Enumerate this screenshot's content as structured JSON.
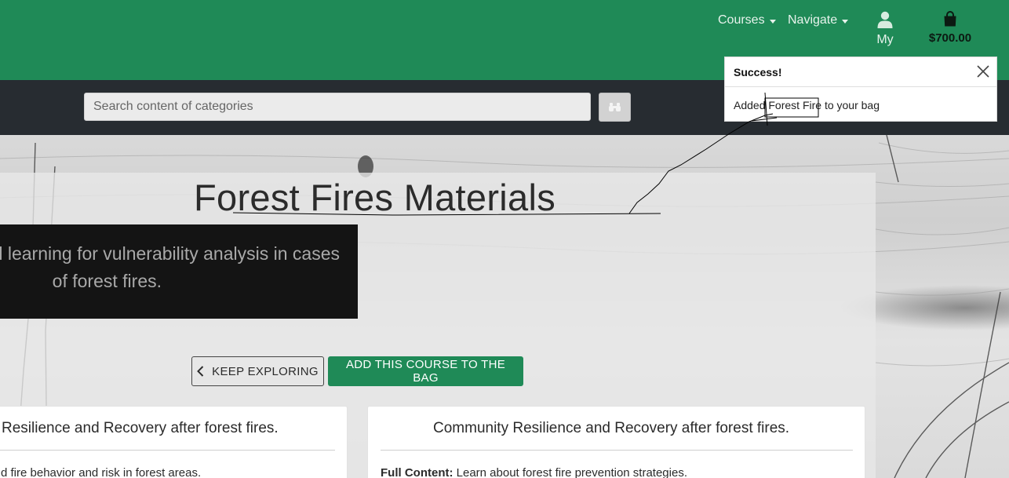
{
  "nav": {
    "courses_label": "Courses",
    "navigate_label": "Navigate",
    "account_label": "My",
    "bag_total": "$700.00"
  },
  "search": {
    "placeholder": "Search content of categories",
    "button_icon": "binoculars-icon"
  },
  "toast": {
    "title": "Success!",
    "message_prefix": "Added ",
    "message_course": "Forest Fire",
    "message_suffix": " to your bag"
  },
  "hero": {
    "title": "Forest Fires Materials",
    "subtitle_line1": "tal learning for vulnerability analysis in cases",
    "subtitle_line2": "of forest fires.",
    "keep_exploring_label": "KEEP EXPLORING",
    "add_to_bag_label": "ADD THIS COURSE TO THE BAG"
  },
  "cards": [
    {
      "title": "Resilience and Recovery after forest fires.",
      "body_prefix": "",
      "body_text": "d fire behavior and risk in forest areas."
    },
    {
      "title": "Community Resilience and Recovery after forest fires.",
      "body_prefix": "Full Content:",
      "body_text": " Learn about forest fire prevention strategies."
    }
  ],
  "colors": {
    "brand_green": "#1f8a57",
    "search_band": "#272c31",
    "bag_text": "#0c1a12"
  }
}
